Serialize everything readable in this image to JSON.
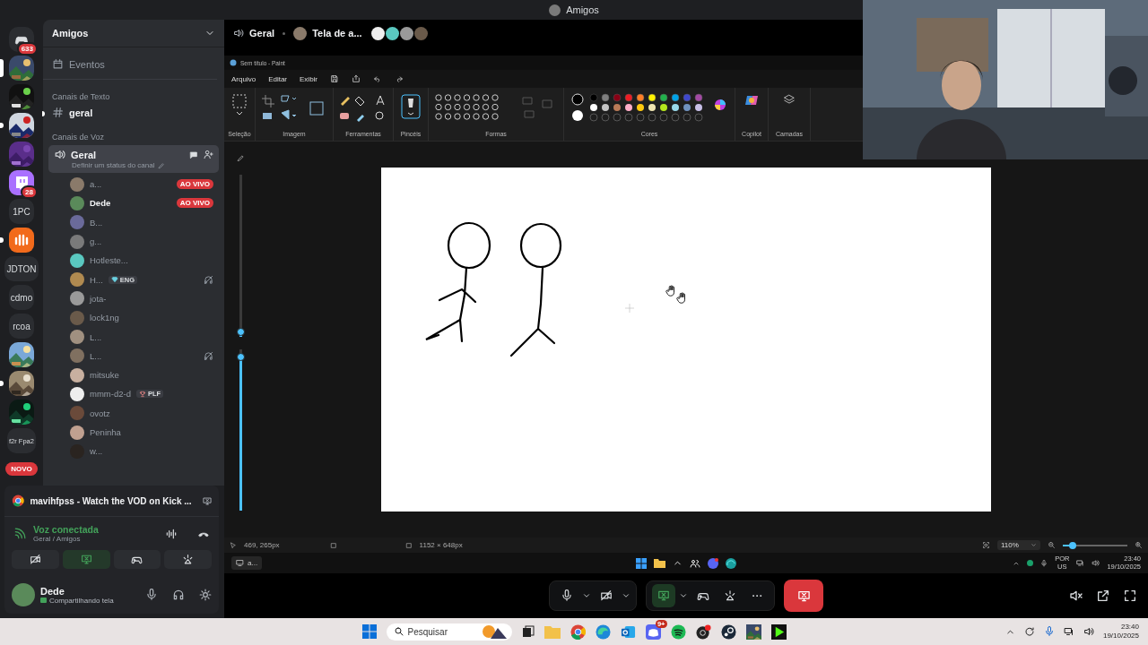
{
  "title_bar": {
    "title": "Amigos"
  },
  "servers": [
    {
      "kind": "logo",
      "badge": "633",
      "selected": false,
      "unread": false
    },
    {
      "kind": "picture",
      "selected": true,
      "unread": false
    },
    {
      "kind": "picture",
      "selected": false,
      "unread": false
    },
    {
      "kind": "picture",
      "selected": false,
      "unread": true
    },
    {
      "kind": "picture",
      "selected": false,
      "unread": false
    },
    {
      "kind": "twitch",
      "badge": "28",
      "selected": false,
      "unread": false
    },
    {
      "kind": "text",
      "label": "1PC",
      "selected": false,
      "unread": false
    },
    {
      "kind": "orange",
      "selected": false,
      "unread": true
    },
    {
      "kind": "text",
      "label": "JDTON",
      "selected": false,
      "unread": false
    },
    {
      "kind": "text",
      "label": "cdmo",
      "selected": false,
      "unread": false
    },
    {
      "kind": "text",
      "label": "rcoa",
      "selected": false,
      "unread": false
    },
    {
      "kind": "picture",
      "selected": false,
      "unread": false
    },
    {
      "kind": "picture",
      "selected": false,
      "unread": true
    },
    {
      "kind": "picture",
      "selected": false,
      "unread": false
    },
    {
      "kind": "text",
      "label": "f2r Fpa2",
      "selected": false,
      "unread": false
    }
  ],
  "new_badge": "NOVO",
  "channel_panel": {
    "server_name": "Amigos",
    "events": "Eventos",
    "text_category": "Canais de Texto",
    "text_channels": [
      {
        "name": "geral",
        "unread": true
      }
    ],
    "voice_category": "Canais de Voz",
    "voice_channel": {
      "name": "Geral",
      "status": "Definir um status do canal",
      "selected": true
    },
    "members": [
      {
        "name": "a...",
        "live": "AO VIVO",
        "highlighted": false,
        "deafened": false
      },
      {
        "name": "Dede",
        "live": "AO VIVO",
        "highlighted": true,
        "deafened": false
      },
      {
        "name": "B...",
        "highlighted": false,
        "deafened": false
      },
      {
        "name": "g...",
        "highlighted": false,
        "deafened": false
      },
      {
        "name": "Hotleste...",
        "highlighted": false,
        "deafened": false
      },
      {
        "name": "H...",
        "tag": {
          "kind": "gem",
          "label": "ENG"
        },
        "highlighted": false,
        "deafened": true
      },
      {
        "name": "jota-",
        "highlighted": false,
        "deafened": false
      },
      {
        "name": "lock1ng",
        "highlighted": false,
        "deafened": false
      },
      {
        "name": "L...",
        "highlighted": false,
        "deafened": false
      },
      {
        "name": "L...",
        "highlighted": false,
        "deafened": true
      },
      {
        "name": "mitsuke",
        "highlighted": false,
        "deafened": false
      },
      {
        "name": "mmm-d2-d",
        "tag": {
          "kind": "trophy",
          "label": "PLF"
        },
        "highlighted": false,
        "deafened": false
      },
      {
        "name": "ovotz",
        "highlighted": false,
        "deafened": false
      },
      {
        "name": "Peninha",
        "highlighted": false,
        "deafened": false
      },
      {
        "name": "w...",
        "highlighted": false,
        "deafened": false
      }
    ]
  },
  "stream_panel": {
    "title": "mavihfpss - Watch the VOD on Kick ..."
  },
  "voice_status": {
    "label": "Voz conectada",
    "channel": "Geral / Amigos"
  },
  "voice_buttons": [
    {
      "kind": "camera-off",
      "selected": false
    },
    {
      "kind": "screen-share",
      "selected": true
    },
    {
      "kind": "gamepad",
      "selected": false
    },
    {
      "kind": "soundboard",
      "selected": false
    }
  ],
  "user": {
    "name": "Dede",
    "status": "Compartilhando tela"
  },
  "stream_header": {
    "channel": "Geral",
    "stream": "Tela de a..."
  },
  "paint": {
    "title": "Sem título - Paint",
    "menu": [
      "Arquivo",
      "Editar",
      "Exibir"
    ],
    "groups": [
      "Seleção",
      "Imagem",
      "Ferramentas",
      "Pincéis",
      "Formas",
      "Cores",
      "Copilot",
      "Camadas"
    ],
    "sliders": [
      {
        "level": 0.03
      },
      {
        "level": 0.95
      }
    ],
    "status": {
      "position": "469, 265px",
      "size": "1152 × 648px",
      "zoom": "110%"
    },
    "zoom_slider": {
      "level": 0.15
    }
  },
  "stream_taskbar": {
    "window": "a...",
    "language": "POR",
    "layout": "US",
    "time": "23:40",
    "date": "19/10/2025"
  },
  "call_controls": {
    "sharing": true
  },
  "taskbar": {
    "search_placeholder": "Pesquisar",
    "chat_badge": "9+",
    "time": "23:40",
    "date": "19/10/2025"
  }
}
